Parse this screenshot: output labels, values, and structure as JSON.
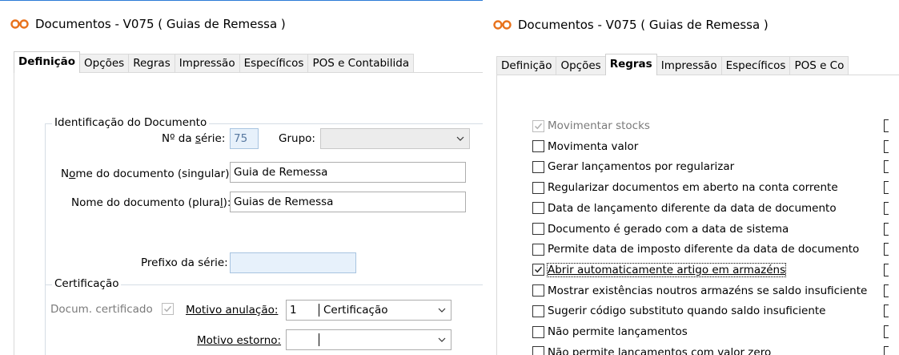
{
  "left_window": {
    "title": "Documentos - V075 ( Guias de Remessa )",
    "tabs": [
      "Definição",
      "Opções",
      "Regras",
      "Impressão",
      "Específicos",
      "POS e Contabilida"
    ],
    "active_tab": "Definição",
    "identification": {
      "legend": "Identificação do Documento",
      "serie_label": "Nº da série:",
      "serie_value": "75",
      "grupo_label": "Grupo:",
      "grupo_value": "",
      "singular_label": "Nome do documento (singular):",
      "singular_value": "Guia de Remessa",
      "plural_label": "Nome do documento (plural):",
      "plural_value": "Guias de Remessa",
      "prefix_label": "Prefixo da série:",
      "prefix_value": ""
    },
    "certification": {
      "legend": "Certificação",
      "docum_label": "Docum. certificado",
      "docum_checked": true,
      "anulacao_label": "Motivo anulação:",
      "anulacao_code": "1",
      "anulacao_text": "Certificação",
      "estorno_label": "Motivo estorno:",
      "estorno_code": "",
      "estorno_text": ""
    }
  },
  "right_window": {
    "title": "Documentos - V075 ( Guias de Remessa )",
    "tabs": [
      "Definição",
      "Opções",
      "Regras",
      "Impressão",
      "Específicos",
      "POS e Co"
    ],
    "active_tab": "Regras",
    "rules": [
      {
        "label": "Movimentar stocks",
        "checked": true,
        "disabled": true
      },
      {
        "label": "Movimenta valor",
        "checked": false,
        "disabled": false
      },
      {
        "label": "Gerar lançamentos por regularizar",
        "checked": false,
        "disabled": false
      },
      {
        "label": "Regularizar documentos em aberto na conta corrente",
        "checked": false,
        "disabled": false
      },
      {
        "label": "Data de lançamento diferente da data de documento",
        "checked": false,
        "disabled": false
      },
      {
        "label": "Documento é gerado com a data de sistema",
        "checked": false,
        "disabled": false
      },
      {
        "label": "Permite data de imposto diferente da data de documento",
        "checked": false,
        "disabled": false
      },
      {
        "label": "Abrir automaticamente artigo em armazéns",
        "checked": true,
        "disabled": false
      },
      {
        "label": "Mostrar existências noutros armazéns se saldo insuficiente",
        "checked": false,
        "disabled": false
      },
      {
        "label": "Sugerir código substituto quando saldo insuficiente",
        "checked": false,
        "disabled": false
      },
      {
        "label": "Não permite lançamentos",
        "checked": false,
        "disabled": false
      },
      {
        "label": "Não permite lançamentos com valor zero",
        "checked": false,
        "disabled": false
      }
    ]
  },
  "colors": {
    "title_accent": "#2b7bd6",
    "field_blue": "#e7f1fb",
    "logo": "#e8721c"
  },
  "icons": {
    "logo": "infinity-logo-icon",
    "dropdown": "chevron-down-icon",
    "check": "checkmark-icon"
  }
}
